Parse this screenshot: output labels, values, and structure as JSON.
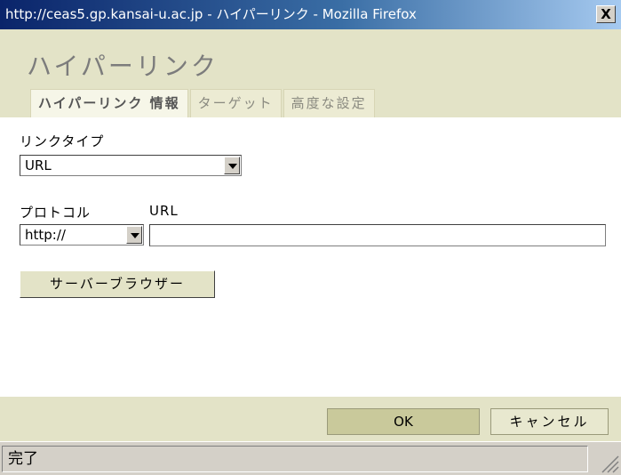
{
  "window": {
    "title": "http://ceas5.gp.kansai-u.ac.jp - ハイパーリンク - Mozilla Firefox",
    "close_label": "X"
  },
  "dialog": {
    "title": "ハイパーリンク",
    "tabs": [
      {
        "label": "ハイパーリンク 情報",
        "active": true
      },
      {
        "label": "ターゲット",
        "active": false
      },
      {
        "label": "高度な設定",
        "active": false
      }
    ]
  },
  "form": {
    "link_type_label": "リンクタイプ",
    "link_type_value": "URL",
    "protocol_label": "プロトコル",
    "protocol_value": "http://",
    "url_label": "URL",
    "url_value": "",
    "server_browser_label": "サーバーブラウザー"
  },
  "footer": {
    "ok_label": "OK",
    "cancel_label": "キャンセル"
  },
  "status": {
    "text": "完了"
  }
}
